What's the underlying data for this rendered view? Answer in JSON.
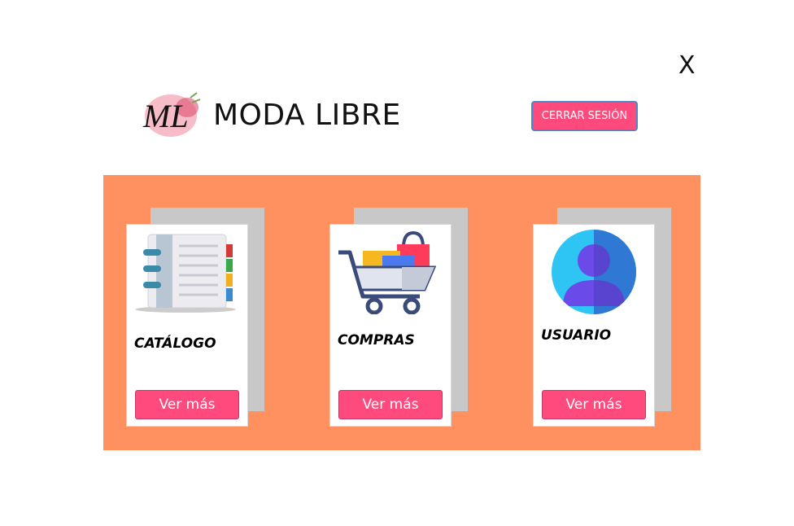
{
  "window": {
    "close_label": "X"
  },
  "header": {
    "logo_text": "ML",
    "brand": "MODA LIBRE",
    "logout_label": "CERRAR SESIÓN"
  },
  "cards": [
    {
      "title": "CATÁLOGO",
      "button": "Ver más",
      "icon": "catalog-book-icon"
    },
    {
      "title": "COMPRAS",
      "button": "Ver más",
      "icon": "shopping-cart-icon"
    },
    {
      "title": "USUARIO",
      "button": "Ver más",
      "icon": "user-avatar-icon"
    }
  ],
  "colors": {
    "accent": "#fe4a7c",
    "panel": "#ff9060",
    "card_shadow": "#c8c8c8"
  }
}
